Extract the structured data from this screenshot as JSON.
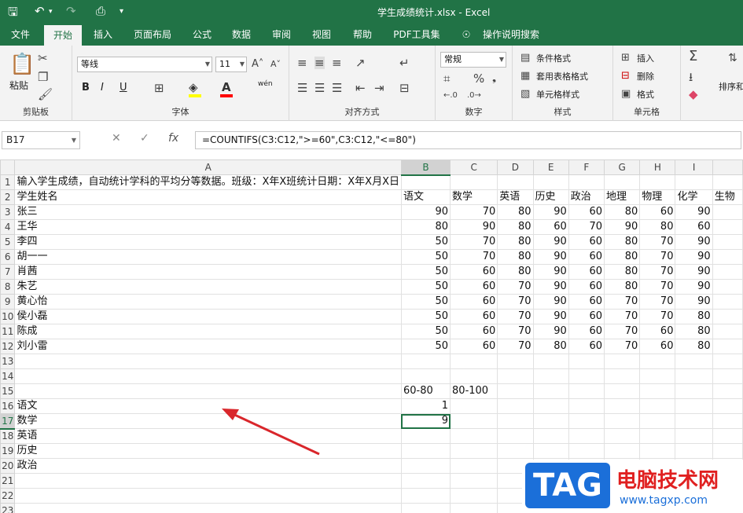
{
  "titlebar": {
    "title": "学生成绩统计.xlsx  -  Excel",
    "icons": [
      "save-icon",
      "undo-icon",
      "redo-icon",
      "print-preview-icon",
      "customize-icon"
    ]
  },
  "menu": {
    "tabs": [
      "文件",
      "开始",
      "插入",
      "页面布局",
      "公式",
      "数据",
      "审阅",
      "视图",
      "帮助",
      "PDF工具集",
      "操作说明搜索"
    ],
    "active": "开始"
  },
  "ribbon": {
    "clipboard": {
      "paste": "粘贴",
      "label": "剪贴板"
    },
    "font": {
      "name": "等线",
      "size": "11",
      "label": "字体",
      "bold": "B",
      "italic": "I",
      "underline": "U",
      "phonetic": "wén"
    },
    "alignment": {
      "label": "对齐方式"
    },
    "number": {
      "format": "常规",
      "label": "数字"
    },
    "styles": {
      "conditional": "条件格式",
      "table": "套用表格格式",
      "cell": "单元格样式",
      "label": "样式"
    },
    "cells": {
      "insert": "插入",
      "delete": "删除",
      "format": "格式",
      "label": "单元格"
    },
    "editing": {
      "sort": "排序和"
    }
  },
  "formula_bar": {
    "name_box": "B17",
    "formula": "=COUNTIFS(C3:C12,\">=60\",C3:C12,\"<=80\")"
  },
  "sheet": {
    "columns": [
      "A",
      "B",
      "C",
      "D",
      "E",
      "F",
      "G",
      "H",
      "I",
      ""
    ],
    "rows": [
      [
        "输入学生成绩，自动统计学科的平均分等数据。班级：X年X班统计日期：X年X月X日",
        "",
        "",
        "",
        "",
        "",
        "",
        "",
        "",
        ""
      ],
      [
        "学生姓名",
        "语文",
        "数学",
        "英语",
        "历史",
        "政治",
        "地理",
        "物理",
        "化学",
        "生物"
      ],
      [
        "张三",
        "90",
        "70",
        "80",
        "90",
        "60",
        "80",
        "60",
        "90",
        ""
      ],
      [
        "王华",
        "80",
        "90",
        "80",
        "60",
        "70",
        "90",
        "80",
        "60",
        ""
      ],
      [
        "李四",
        "50",
        "70",
        "80",
        "90",
        "60",
        "80",
        "70",
        "90",
        ""
      ],
      [
        "胡一一",
        "50",
        "70",
        "80",
        "90",
        "60",
        "80",
        "70",
        "90",
        ""
      ],
      [
        "肖茜",
        "50",
        "60",
        "80",
        "90",
        "60",
        "80",
        "70",
        "90",
        ""
      ],
      [
        "朱艺",
        "50",
        "60",
        "70",
        "90",
        "60",
        "80",
        "70",
        "90",
        ""
      ],
      [
        "黄心怡",
        "50",
        "60",
        "70",
        "90",
        "60",
        "70",
        "70",
        "90",
        ""
      ],
      [
        "侯小磊",
        "50",
        "60",
        "70",
        "90",
        "60",
        "70",
        "70",
        "80",
        ""
      ],
      [
        "陈成",
        "50",
        "60",
        "70",
        "90",
        "60",
        "70",
        "60",
        "80",
        ""
      ],
      [
        "刘小雷",
        "50",
        "60",
        "70",
        "80",
        "60",
        "70",
        "60",
        "80",
        ""
      ],
      [
        "",
        "",
        "",
        "",
        "",
        "",
        "",
        "",
        "",
        ""
      ],
      [
        "",
        "",
        "",
        "",
        "",
        "",
        "",
        "",
        "",
        ""
      ],
      [
        "",
        "60-80",
        "80-100",
        "",
        "",
        "",
        "",
        "",
        "",
        ""
      ],
      [
        "语文",
        "1",
        "",
        "",
        "",
        "",
        "",
        "",
        "",
        ""
      ],
      [
        "数学",
        "9",
        "",
        "",
        "",
        "",
        "",
        "",
        "",
        ""
      ],
      [
        "英语",
        "",
        "",
        "",
        "",
        "",
        "",
        "",
        "",
        ""
      ],
      [
        "历史",
        "",
        "",
        "",
        "",
        "",
        "",
        "",
        "",
        ""
      ],
      [
        "政治",
        "",
        "",
        "",
        "",
        "",
        "",
        "",
        "",
        ""
      ],
      [
        "",
        "",
        "",
        "",
        "",
        "",
        "",
        "",
        "",
        ""
      ],
      [
        "",
        "",
        "",
        "",
        "",
        "",
        "",
        "",
        "",
        ""
      ],
      [
        "",
        "",
        "",
        "",
        "",
        "",
        "",
        "",
        "",
        ""
      ],
      [
        "",
        "",
        "",
        "",
        "",
        "",
        "",
        "",
        "",
        ""
      ]
    ]
  },
  "watermark": {
    "tag": "TAG",
    "site_name": "电脑技术网",
    "url": "www.tagxp.com"
  },
  "colors": {
    "excel_green": "#217346",
    "arrow_red": "#d9262b"
  }
}
